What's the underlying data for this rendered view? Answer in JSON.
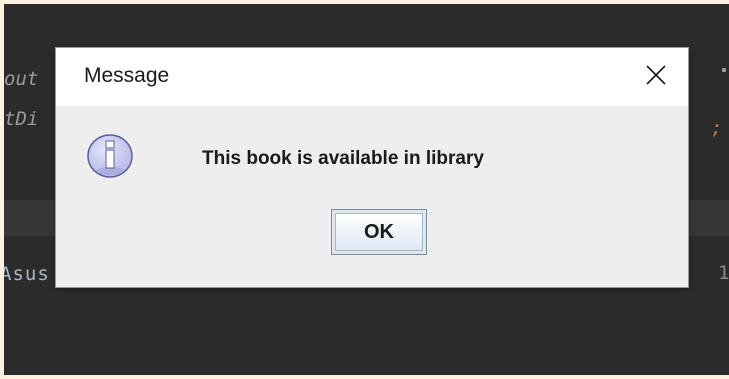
{
  "background_code": {
    "line1": "out",
    "line2": "tDi",
    "line3": "Asus",
    "right_semicolon": ";",
    "right_digit": "1"
  },
  "dialog": {
    "title": "Message",
    "close_icon": "close-icon",
    "message_icon": "info-icon",
    "message": "This book is available in library",
    "ok_label": "OK"
  },
  "colors": {
    "ide_background": "#2b2b2b",
    "dialog_body": "#eeeeee",
    "titlebar": "#ffffff",
    "info_icon_fill": "#c6c8f0",
    "keyword_orange": "#cc7832"
  }
}
